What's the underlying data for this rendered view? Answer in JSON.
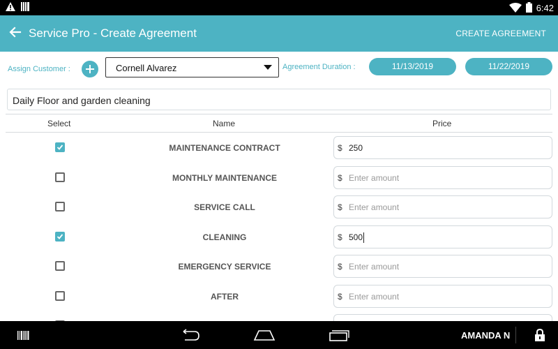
{
  "status_bar": {
    "time": "6:42",
    "left_icons": [
      "warning-icon",
      "sim-icon"
    ],
    "right_icons": [
      "wifi-icon",
      "battery-icon"
    ]
  },
  "app_bar": {
    "title": "Service Pro - Create Agreement",
    "action_label": "CREATE AGREEMENT"
  },
  "assign": {
    "label": "Assign Customer :",
    "customer": "Cornell Alvarez"
  },
  "duration": {
    "label": "Agreement Duration :",
    "start": "11/13/2019",
    "end": "11/22/2019"
  },
  "description": "Daily Floor and garden cleaning",
  "table": {
    "headers": {
      "select": "Select",
      "name": "Name",
      "price": "Price"
    },
    "currency": "$",
    "placeholder": "Enter amount",
    "rows": [
      {
        "name": "MAINTENANCE CONTRACT",
        "checked": true,
        "amount": "250"
      },
      {
        "name": "MONTHLY MAINTENANCE",
        "checked": false,
        "amount": ""
      },
      {
        "name": "SERVICE CALL",
        "checked": false,
        "amount": ""
      },
      {
        "name": "CLEANING",
        "checked": true,
        "amount": "500"
      },
      {
        "name": "EMERGENCY SERVICE",
        "checked": false,
        "amount": ""
      },
      {
        "name": "AFTER",
        "checked": false,
        "amount": ""
      },
      {
        "name": "",
        "checked": false,
        "amount": ""
      }
    ],
    "focused_row": 3
  },
  "nav_bar": {
    "user": "AMANDA N",
    "icons": [
      "barcode-icon",
      "back-icon",
      "home-icon",
      "recents-icon",
      "lock-icon"
    ]
  },
  "colors": {
    "accent": "#4db3c3",
    "status_bar": "#000000"
  }
}
